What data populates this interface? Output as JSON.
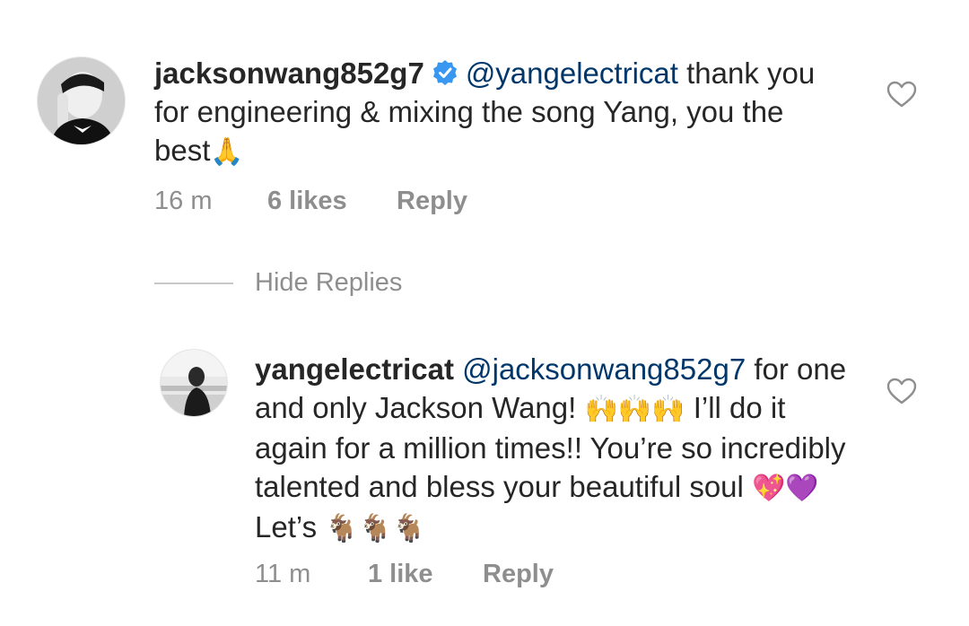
{
  "comment": {
    "username": "jacksonwang852g7",
    "verified_icon": "verified-badge-icon",
    "mention": "@yangelectricat",
    "text_part1": " thank you for engineering & mixing the song Yang, you the best",
    "emoji": "🙏",
    "time": "16 m",
    "likes": "6 likes",
    "reply_label": "Reply",
    "like_icon": "heart-outline-icon"
  },
  "hide_replies_label": "Hide Replies",
  "reply": {
    "username": "yangelectricat",
    "mention": "@jacksonwang852g7",
    "text_part1": " for one and only Jackson Wang! ",
    "emoji_hands": "🙌🙌🙌",
    "text_part2": " I’ll do it again for a million times!! You’re so incredibly talented and bless your beautiful soul ",
    "emoji_hearts_1": "💖",
    "emoji_hearts_2": "💜",
    "text_part3": " Let’s ",
    "emoji_goats": "🐐🐐🐐",
    "time": "11 m",
    "likes": "1 like",
    "reply_label": "Reply",
    "like_icon": "heart-outline-icon"
  },
  "colors": {
    "text": "#262626",
    "secondary": "#8e8e8e",
    "mention": "#00376b",
    "verified": "#3897f0"
  }
}
